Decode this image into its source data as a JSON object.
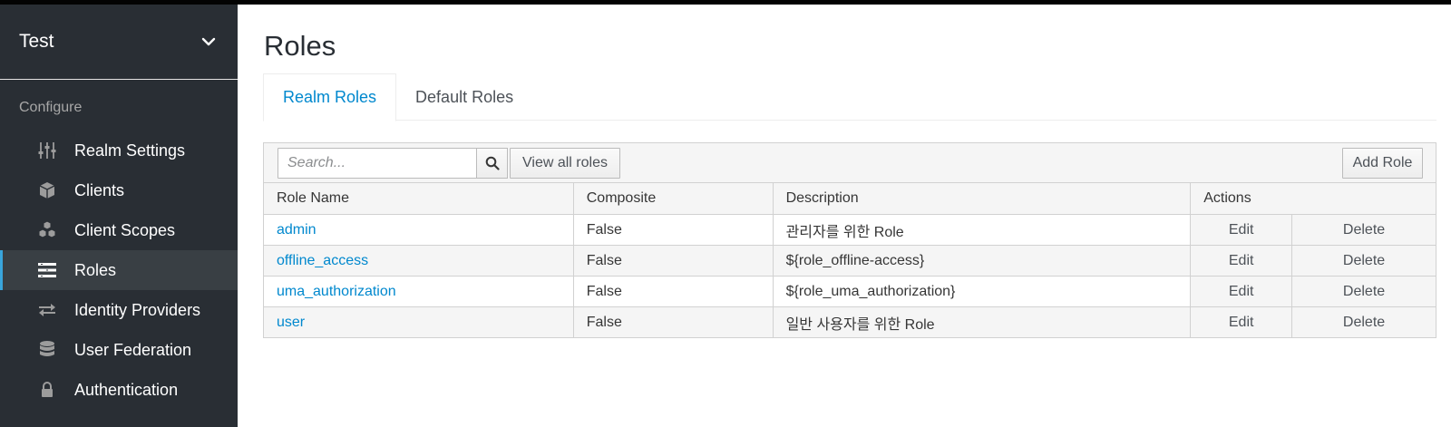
{
  "realm": {
    "name": "Test"
  },
  "sidebar": {
    "section_label": "Configure",
    "items": [
      {
        "label": "Realm Settings",
        "icon": "sliders-icon",
        "active": false
      },
      {
        "label": "Clients",
        "icon": "cube-icon",
        "active": false
      },
      {
        "label": "Client Scopes",
        "icon": "cubes-icon",
        "active": false
      },
      {
        "label": "Roles",
        "icon": "list-icon",
        "active": true
      },
      {
        "label": "Identity Providers",
        "icon": "exchange-icon",
        "active": false
      },
      {
        "label": "User Federation",
        "icon": "database-icon",
        "active": false
      },
      {
        "label": "Authentication",
        "icon": "lock-icon",
        "active": false
      }
    ]
  },
  "page": {
    "title": "Roles"
  },
  "tabs": [
    {
      "label": "Realm Roles",
      "active": true
    },
    {
      "label": "Default Roles",
      "active": false
    }
  ],
  "toolbar": {
    "search_placeholder": "Search...",
    "view_all_label": "View all roles",
    "add_role_label": "Add Role"
  },
  "table": {
    "headers": [
      "Role Name",
      "Composite",
      "Description",
      "Actions"
    ],
    "rows": [
      {
        "name": "admin",
        "composite": "False",
        "description": "관리자를 위한 Role",
        "edit": "Edit",
        "delete": "Delete"
      },
      {
        "name": "offline_access",
        "composite": "False",
        "description": "${role_offline-access}",
        "edit": "Edit",
        "delete": "Delete"
      },
      {
        "name": "uma_authorization",
        "composite": "False",
        "description": "${role_uma_authorization}",
        "edit": "Edit",
        "delete": "Delete"
      },
      {
        "name": "user",
        "composite": "False",
        "description": "일반 사용자를 위한 Role",
        "edit": "Edit",
        "delete": "Delete"
      }
    ]
  },
  "colors": {
    "sidebar_bg": "#292e34",
    "sidebar_active_bg": "#393f44",
    "accent": "#0088ce",
    "active_bar": "#39a5dc"
  }
}
